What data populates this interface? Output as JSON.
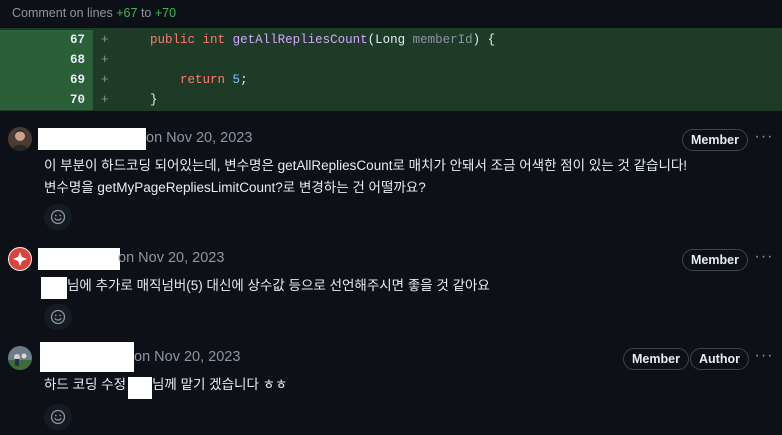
{
  "header": {
    "prefix": "Comment on lines",
    "from": "+67",
    "middle": "to",
    "to": "+70"
  },
  "diff": {
    "lines": [
      {
        "num": "67",
        "sign": "+"
      },
      {
        "num": "68",
        "sign": "+"
      },
      {
        "num": "69",
        "sign": "+"
      },
      {
        "num": "70",
        "sign": "+"
      }
    ],
    "code": {
      "l1_public": "public",
      "l1_int": "int",
      "l1_fn": "getAllRepliesCount",
      "l1_paren": "(",
      "l1_type": "Long",
      "l1_param": "memberId",
      "l1_end": ") {",
      "l3_return": "return",
      "l3_num": "5",
      "l3_semi": ";",
      "l4_brace": "}"
    }
  },
  "comments": [
    {
      "date": "on Nov 20, 2023",
      "badges": [
        "Member"
      ],
      "body_lines": [
        "이 부분이 하드코딩 되어있는데, 변수명은 getAllRepliesCount로 매치가 안돼서 조금 어색한 점이 있는 것 같습니다!",
        "변수명을 getMyPageRepliesLimitCount?로 변경하는 건 어떨까요?"
      ],
      "reaction_icon": "smiley-icon",
      "menu_icon": "kebab-icon"
    },
    {
      "date": "on Nov 20, 2023",
      "badges": [
        "Member"
      ],
      "body_lines": [
        "님에 추가로 매직넘버(5) 대신에 상수값 등으로 선언해주시면 좋을 것 같아요"
      ],
      "reaction_icon": "smiley-icon",
      "menu_icon": "kebab-icon"
    },
    {
      "date": "on Nov 20, 2023",
      "badges": [
        "Member",
        "Author"
      ],
      "body_parts": [
        "하드 코딩 수정 ",
        "님께 맡기 겠습니다 ㅎㅎ"
      ],
      "reaction_icon": "smiley-icon",
      "menu_icon": "kebab-icon"
    }
  ],
  "colors": {
    "background": "#0d1117",
    "diff_added_bg": "#1d3b26",
    "diff_gutter_bg": "#2a5f38",
    "added_text": "#3fb950",
    "muted_text": "#8d96a0"
  }
}
